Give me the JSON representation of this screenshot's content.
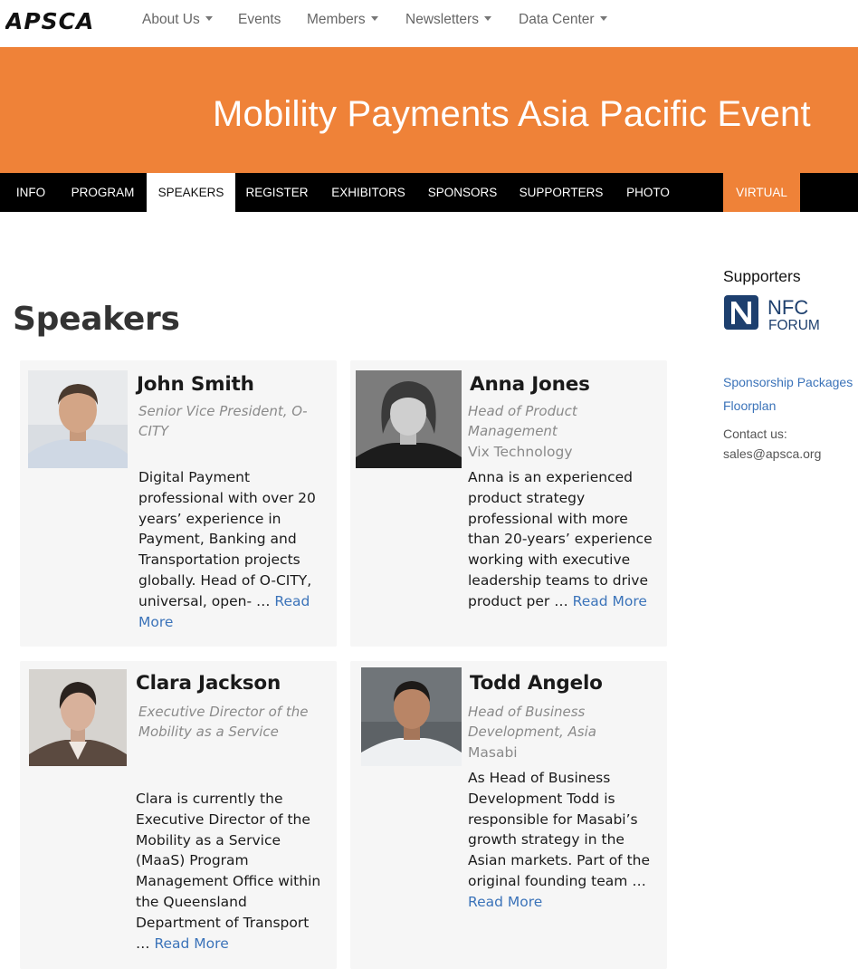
{
  "brand": {
    "logo_text": "APSCA"
  },
  "topnav": {
    "items": [
      {
        "label": "About Us",
        "dropdown": true
      },
      {
        "label": "Events",
        "dropdown": false
      },
      {
        "label": "Members",
        "dropdown": true
      },
      {
        "label": "Newsletters",
        "dropdown": true
      },
      {
        "label": "Data Center",
        "dropdown": true
      }
    ]
  },
  "banner": {
    "title": "Mobility Payments Asia Pacific Event"
  },
  "event_nav": {
    "tabs": [
      "INFO",
      "PROGRAM",
      "SPEAKERS",
      "REGISTER",
      "EXHIBITORS",
      "SPONSORS",
      "SUPPORTERS",
      "PHOTO",
      "VIRTUAL"
    ],
    "active": "SPEAKERS"
  },
  "page": {
    "title": "Speakers"
  },
  "speakers": [
    {
      "name": "John Smith",
      "title": "Senior Vice President, O-CITY",
      "company": "",
      "bio": "Digital Payment professional with over 20 years’ experience in Payment, Banking and Transportation projects globally. Head of O-CITY, universal, open- …",
      "read_more": "Read More"
    },
    {
      "name": "Anna Jones",
      "title": "Head of Product Management",
      "company": "Vix Technology",
      "bio": "Anna is an experienced product strategy professional with more than 20-years’ experience working with executive leadership teams to drive product per …",
      "read_more": "Read More"
    },
    {
      "name": "Clara Jackson",
      "title": "Executive Director of the Mobility as a Service",
      "company": "",
      "bio": "Clara is currently the Executive Director of the Mobility as a Service (MaaS) Program Management Office within the Queensland Department of Transport …",
      "read_more": "Read More"
    },
    {
      "name": "Todd Angelo",
      "title": "Head of Business Development, Asia",
      "company": "Masabi",
      "bio": "As Head of Business Development Todd is responsible for Masabi’s growth strategy in the Asian markets. Part of the original founding team …",
      "read_more": "Read More"
    }
  ],
  "sidebar": {
    "heading": "Supporters",
    "supporter_logo": {
      "line1": "NFC",
      "line2": "FORUM"
    },
    "links": [
      "Sponsorship Packages",
      "Floorplan"
    ],
    "contact_label": "Contact us:",
    "contact_email": "sales@apsca.org"
  },
  "colors": {
    "accent": "#ef8238",
    "link": "#3b73b9",
    "nav_bg": "#000000",
    "card_bg": "#f6f6f6",
    "nfc_blue": "#1d3f6e"
  }
}
